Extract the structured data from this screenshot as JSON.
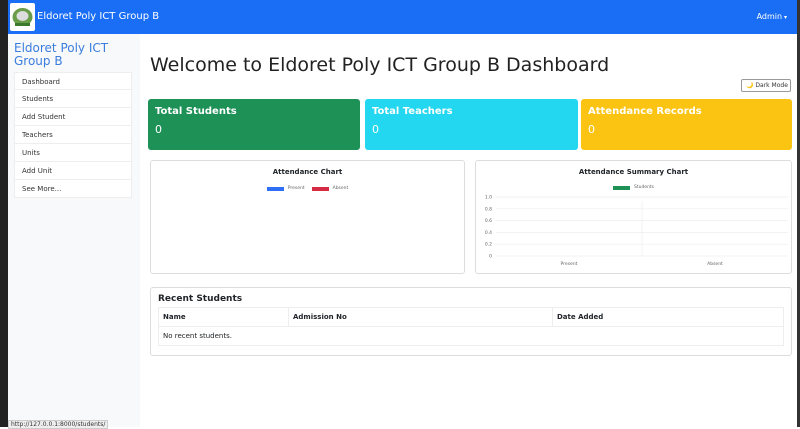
{
  "navbar": {
    "brand": "Eldoret Poly ICT Group B",
    "user_menu": "Admin"
  },
  "sidebar": {
    "title": "Eldoret Poly ICT Group B",
    "items": [
      "Dashboard",
      "Students",
      "Add Student",
      "Teachers",
      "Units",
      "Add Unit",
      "See More..."
    ]
  },
  "main": {
    "title": "Welcome to Eldoret Poly ICT Group B Dashboard",
    "dark_mode_label": "Dark Mode",
    "stats": [
      {
        "label": "Total Students",
        "value": "0",
        "color": "#1e9157"
      },
      {
        "label": "Total Teachers",
        "value": "0",
        "color": "#22d7ef"
      },
      {
        "label": "Attendance Records",
        "value": "0",
        "color": "#fcc412"
      }
    ]
  },
  "chart_data": [
    {
      "type": "pie",
      "title": "Attendance Chart",
      "legend": [
        "Present",
        "Absent"
      ],
      "colors": [
        "#2f6ff6",
        "#d72a44"
      ],
      "values": []
    },
    {
      "type": "bar",
      "title": "Attendance Summary Chart",
      "categories": [
        "Present",
        "Absent"
      ],
      "series": [
        {
          "name": "Students",
          "values": [
            0,
            0
          ],
          "color": "#1e9157"
        }
      ],
      "ylim": [
        0,
        1
      ],
      "yticks": [
        "0",
        "0.2",
        "0.4",
        "0.6",
        "0.8",
        "1.0"
      ]
    }
  ],
  "recent": {
    "title": "Recent Students",
    "columns": [
      "Name",
      "Admission No",
      "Date Added"
    ],
    "empty": "No recent students."
  },
  "status_url": "http://127.0.0.1:8000/students/"
}
